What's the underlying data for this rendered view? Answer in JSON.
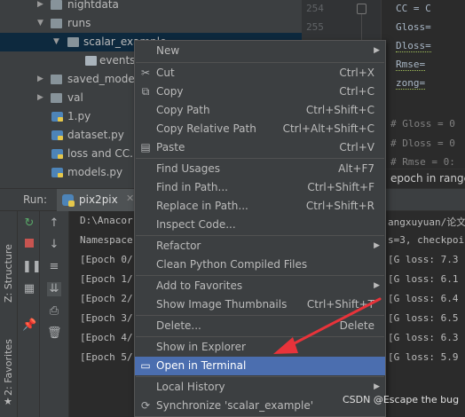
{
  "tree": {
    "items": [
      {
        "label": "nightdata"
      },
      {
        "label": "runs"
      },
      {
        "label": "scalar_example"
      },
      {
        "label": "events.t"
      },
      {
        "label": "saved_model"
      },
      {
        "label": "val"
      },
      {
        "label": "1.py"
      },
      {
        "label": "dataset.py"
      },
      {
        "label": "loss and CC.py"
      },
      {
        "label": "models.py"
      }
    ]
  },
  "editor": {
    "line_numbers": [
      "254",
      "255"
    ],
    "code_lines": [
      "CC = C",
      "Gloss=",
      "Dloss=",
      "Rmse=",
      "zong=",
      "# Gloss = 0",
      "# Dloss = 0",
      "# Rmse = 0:"
    ],
    "breadcrumb": "epoch in range"
  },
  "run": {
    "label": "Run:",
    "tab": "pix2pix"
  },
  "side": {
    "structure": "Z: Structure",
    "favorites": "2: Favorites"
  },
  "console": {
    "left_lines": [
      "D:\\Anacor",
      "Namespace",
      "[Epoch 0/",
      "[Epoch 1/",
      "[Epoch 2/",
      "[Epoch 3/",
      "[Epoch 4/",
      "[Epoch 5/"
    ],
    "right_lines": [
      "angxuyuan/论文",
      "s=3, checkpoi",
      "[G loss: 7.3",
      "[G loss: 6.1",
      "[G loss: 6.4",
      "[G loss: 6.5",
      "[G loss: 6.3",
      "[G loss: 5.9"
    ]
  },
  "menu": {
    "items": [
      {
        "label": "New",
        "shortcut": ""
      },
      {
        "label": "Cut",
        "shortcut": "Ctrl+X"
      },
      {
        "label": "Copy",
        "shortcut": "Ctrl+C"
      },
      {
        "label": "Copy Path",
        "shortcut": "Ctrl+Shift+C"
      },
      {
        "label": "Copy Relative Path",
        "shortcut": "Ctrl+Alt+Shift+C"
      },
      {
        "label": "Paste",
        "shortcut": "Ctrl+V"
      },
      {
        "label": "Find Usages",
        "shortcut": "Alt+F7"
      },
      {
        "label": "Find in Path...",
        "shortcut": "Ctrl+Shift+F"
      },
      {
        "label": "Replace in Path...",
        "shortcut": "Ctrl+Shift+R"
      },
      {
        "label": "Inspect Code...",
        "shortcut": ""
      },
      {
        "label": "Refactor",
        "shortcut": ""
      },
      {
        "label": "Clean Python Compiled Files",
        "shortcut": ""
      },
      {
        "label": "Add to Favorites",
        "shortcut": ""
      },
      {
        "label": "Show Image Thumbnails",
        "shortcut": "Ctrl+Shift+T"
      },
      {
        "label": "Delete...",
        "shortcut": "Delete"
      },
      {
        "label": "Show in Explorer",
        "shortcut": ""
      },
      {
        "label": "Open in Terminal",
        "shortcut": ""
      },
      {
        "label": "Local History",
        "shortcut": ""
      },
      {
        "label": "Synchronize 'scalar_example'",
        "shortcut": ""
      }
    ]
  },
  "watermark": "CSDN @Escape the bug",
  "colors": {
    "highlight": "#4b6eaf",
    "arrow": "#e8333a",
    "selected_tree": "#0d293e"
  }
}
